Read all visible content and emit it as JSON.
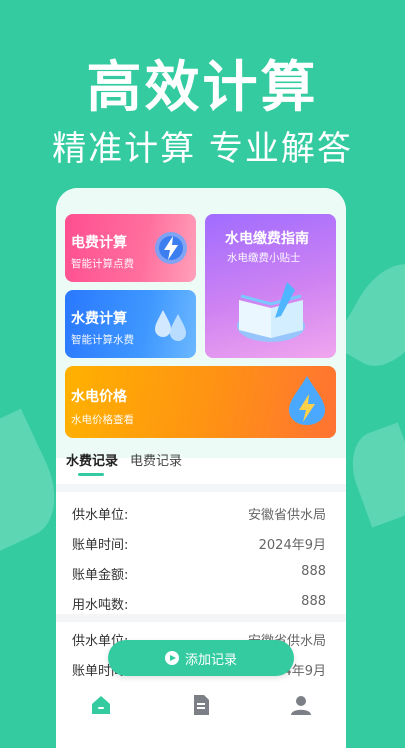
{
  "hero": {
    "title": "高效计算",
    "subtitle": "精准计算 专业解答"
  },
  "cards": {
    "electricity": {
      "title": "电费计算",
      "subtitle": "智能计算点费",
      "icon": "lightning-drop-icon",
      "color": "#ff5c95"
    },
    "water": {
      "title": "水费计算",
      "subtitle": "智能计算水费",
      "icon": "water-drops-icon",
      "color": "#3a8cff"
    },
    "guide": {
      "title": "水电缴费指南",
      "subtitle": "水电缴费小贴士",
      "icon": "book-icon",
      "color": "#b77af7"
    },
    "price": {
      "title": "水电价格",
      "subtitle": "水电价格查看",
      "icon": "water-lightning-icon",
      "color": "#ff9a12"
    }
  },
  "tabs": {
    "water_records": "水费记录",
    "electric_records": "电费记录",
    "active_color": "#35cba1"
  },
  "records": [
    {
      "supplier_label": "供水单位:",
      "supplier": "安徽省供水局",
      "time_label": "账单时间:",
      "time": "2024年9月",
      "amount_label": "账单金额:",
      "amount": "888",
      "usage_label": "用水吨数:",
      "usage": "888"
    },
    {
      "supplier_label": "供水单位:",
      "supplier": "安徽省供水局",
      "time_label": "账单时间:",
      "time": "2024年9月"
    }
  ],
  "add_button": {
    "label": "添加记录",
    "icon": "play-circle-icon"
  },
  "bottom_nav": {
    "items": [
      {
        "icon": "home-icon",
        "active": true
      },
      {
        "icon": "document-icon",
        "active": false
      },
      {
        "icon": "user-icon",
        "active": false
      }
    ]
  },
  "colors": {
    "brand": "#35cba1",
    "background": "#35cba1"
  }
}
